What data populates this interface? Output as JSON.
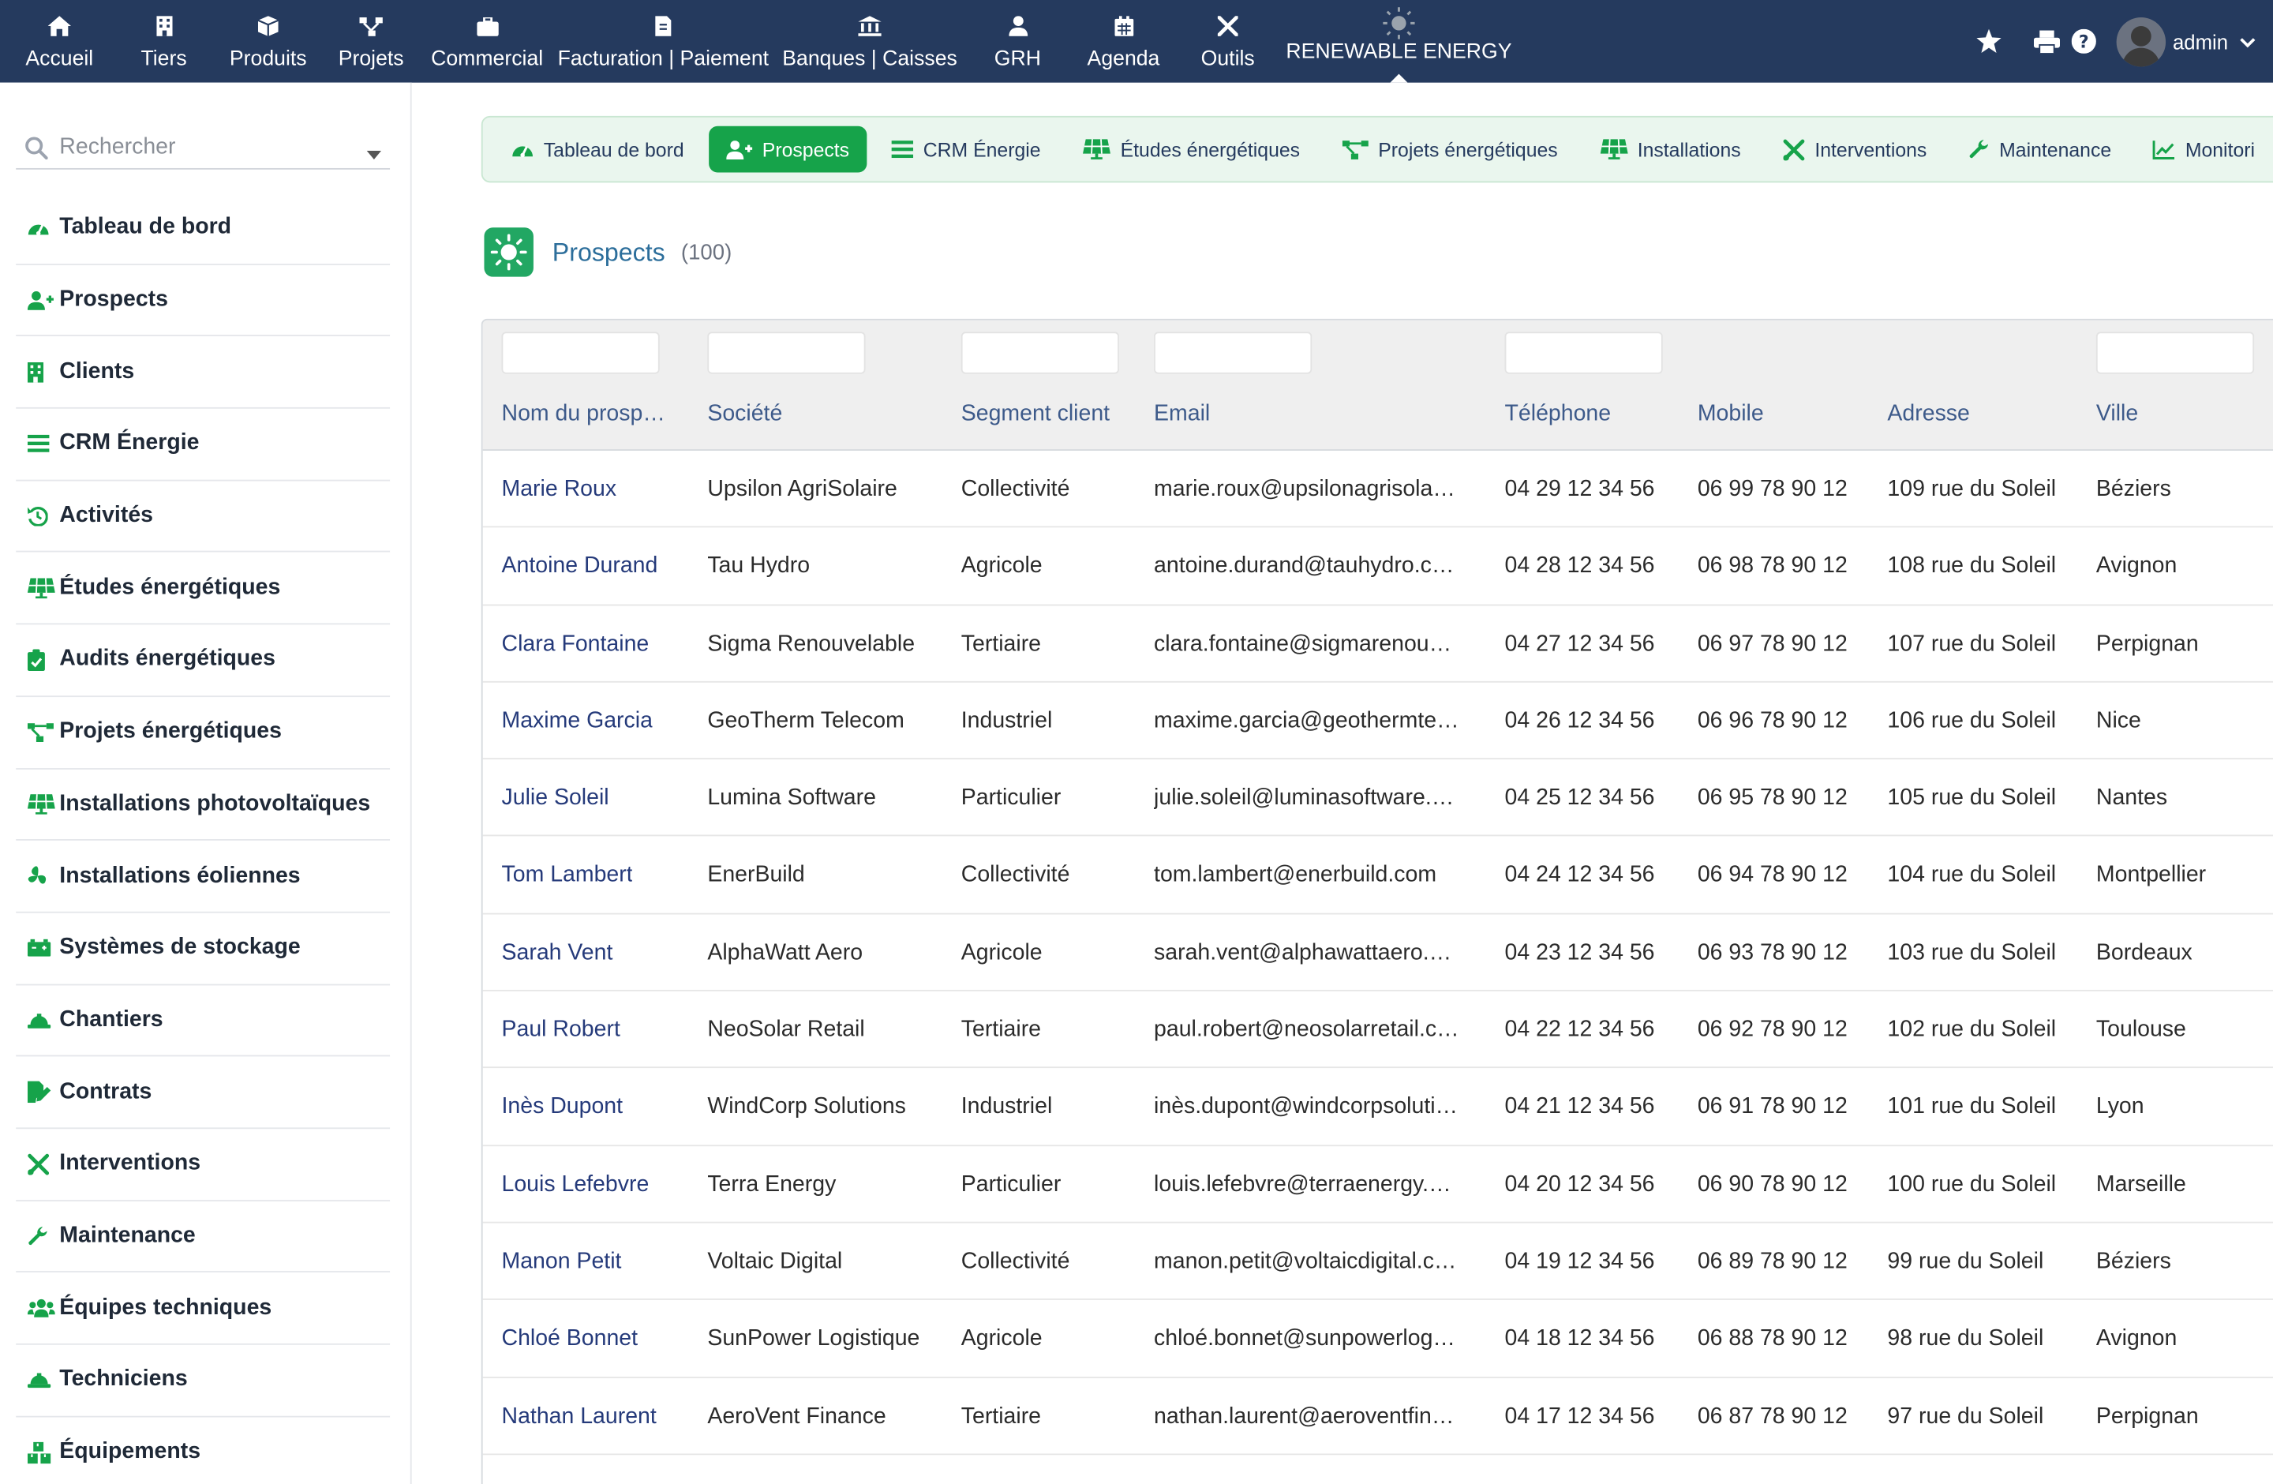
{
  "topnav": {
    "items": [
      {
        "label": "Accueil",
        "icon": "home-icon"
      },
      {
        "label": "Tiers",
        "icon": "building-icon"
      },
      {
        "label": "Produits",
        "icon": "cube-icon"
      },
      {
        "label": "Projets",
        "icon": "project-icon"
      },
      {
        "label": "Commercial",
        "icon": "briefcase-icon"
      },
      {
        "label": "Facturation | Paiement",
        "icon": "invoice-icon"
      },
      {
        "label": "Banques | Caisses",
        "icon": "bank-icon"
      },
      {
        "label": "GRH",
        "icon": "user-tie-icon"
      },
      {
        "label": "Agenda",
        "icon": "calendar-icon"
      },
      {
        "label": "Outils",
        "icon": "tools-icon"
      },
      {
        "label": "RENEWABLE ENERGY",
        "icon": "sun-icon",
        "active": true
      }
    ],
    "user": "admin"
  },
  "sidebar": {
    "search_placeholder": "Rechercher",
    "items": [
      {
        "label": "Tableau de bord",
        "icon": "gauge-icon"
      },
      {
        "label": "Prospects",
        "icon": "user-plus-icon"
      },
      {
        "label": "Clients",
        "icon": "building-icon"
      },
      {
        "label": "CRM Énergie",
        "icon": "list-icon"
      },
      {
        "label": "Activités",
        "icon": "history-icon"
      },
      {
        "label": "Études énergétiques",
        "icon": "solar-panel-icon"
      },
      {
        "label": "Audits énergétiques",
        "icon": "clipboard-check-icon"
      },
      {
        "label": "Projets énergétiques",
        "icon": "project-diagram-icon"
      },
      {
        "label": "Installations photovoltaïques",
        "icon": "solar-panel-icon"
      },
      {
        "label": "Installations éoliennes",
        "icon": "fan-icon"
      },
      {
        "label": "Systèmes de stockage",
        "icon": "battery-icon"
      },
      {
        "label": "Chantiers",
        "icon": "hard-hat-icon"
      },
      {
        "label": "Contrats",
        "icon": "signature-icon"
      },
      {
        "label": "Interventions",
        "icon": "tools-icon"
      },
      {
        "label": "Maintenance",
        "icon": "wrench-icon"
      },
      {
        "label": "Équipes techniques",
        "icon": "users-icon"
      },
      {
        "label": "Techniciens",
        "icon": "hard-hat-icon"
      },
      {
        "label": "Équipements",
        "icon": "boxes-icon"
      }
    ]
  },
  "tabs": [
    {
      "label": "Tableau de bord",
      "icon": "gauge-icon"
    },
    {
      "label": "Prospects",
      "icon": "user-plus-icon",
      "active": true
    },
    {
      "label": "CRM Énergie",
      "icon": "list-icon"
    },
    {
      "label": "Études énergétiques",
      "icon": "solar-panel-icon"
    },
    {
      "label": "Projets énergétiques",
      "icon": "project-diagram-icon"
    },
    {
      "label": "Installations",
      "icon": "solar-panel-icon"
    },
    {
      "label": "Interventions",
      "icon": "tools-icon"
    },
    {
      "label": "Maintenance",
      "icon": "wrench-icon"
    },
    {
      "label": "Monitori",
      "icon": "chart-line-icon"
    }
  ],
  "page": {
    "title": "Prospects",
    "count": "(100)"
  },
  "colors": {
    "navbar": "#253a5e",
    "accent_green": "#16a34a",
    "link": "#253a7a"
  },
  "table": {
    "columns": [
      "Nom du prosp…",
      "Société",
      "Segment client",
      "Email",
      "Téléphone",
      "Mobile",
      "Adresse",
      "Ville"
    ],
    "rows": [
      [
        "Marie Roux",
        "Upsilon AgriSolaire",
        "Collectivité",
        "marie.roux@upsilonagrisola…",
        "04 29 12 34 56",
        "06 99 78 90 12",
        "109 rue du Soleil",
        "Béziers"
      ],
      [
        "Antoine Durand",
        "Tau Hydro",
        "Agricole",
        "antoine.durand@tauhydro.c…",
        "04 28 12 34 56",
        "06 98 78 90 12",
        "108 rue du Soleil",
        "Avignon"
      ],
      [
        "Clara Fontaine",
        "Sigma Renouvelable",
        "Tertiaire",
        "clara.fontaine@sigmarenou…",
        "04 27 12 34 56",
        "06 97 78 90 12",
        "107 rue du Soleil",
        "Perpignan"
      ],
      [
        "Maxime Garcia",
        "GeoTherm Telecom",
        "Industriel",
        "maxime.garcia@geothermte…",
        "04 26 12 34 56",
        "06 96 78 90 12",
        "106 rue du Soleil",
        "Nice"
      ],
      [
        "Julie Soleil",
        "Lumina Software",
        "Particulier",
        "julie.soleil@luminasoftware.…",
        "04 25 12 34 56",
        "06 95 78 90 12",
        "105 rue du Soleil",
        "Nantes"
      ],
      [
        "Tom Lambert",
        "EnerBuild",
        "Collectivité",
        "tom.lambert@enerbuild.com",
        "04 24 12 34 56",
        "06 94 78 90 12",
        "104 rue du Soleil",
        "Montpellier"
      ],
      [
        "Sarah Vent",
        "AlphaWatt Aero",
        "Agricole",
        "sarah.vent@alphawattaero.…",
        "04 23 12 34 56",
        "06 93 78 90 12",
        "103 rue du Soleil",
        "Bordeaux"
      ],
      [
        "Paul Robert",
        "NeoSolar Retail",
        "Tertiaire",
        "paul.robert@neosolarretail.c…",
        "04 22 12 34 56",
        "06 92 78 90 12",
        "102 rue du Soleil",
        "Toulouse"
      ],
      [
        "Inès Dupont",
        "WindCorp Solutions",
        "Industriel",
        "inès.dupont@windcorpsoluti…",
        "04 21 12 34 56",
        "06 91 78 90 12",
        "101 rue du Soleil",
        "Lyon"
      ],
      [
        "Louis Lefebvre",
        "Terra Energy",
        "Particulier",
        "louis.lefebvre@terraenergy.…",
        "04 20 12 34 56",
        "06 90 78 90 12",
        "100 rue du Soleil",
        "Marseille"
      ],
      [
        "Manon Petit",
        "Voltaic Digital",
        "Collectivité",
        "manon.petit@voltaicdigital.c…",
        "04 19 12 34 56",
        "06 89 78 90 12",
        "99 rue du Soleil",
        "Béziers"
      ],
      [
        "Chloé Bonnet",
        "SunPower Logistique",
        "Agricole",
        "chloé.bonnet@sunpowerlog…",
        "04 18 12 34 56",
        "06 88 78 90 12",
        "98 rue du Soleil",
        "Avignon"
      ],
      [
        "Nathan Laurent",
        "AeroVent Finance",
        "Tertiaire",
        "nathan.laurent@aeroventfin…",
        "04 17 12 34 56",
        "06 87 78 90 12",
        "97 rue du Soleil",
        "Perpignan"
      ]
    ]
  }
}
